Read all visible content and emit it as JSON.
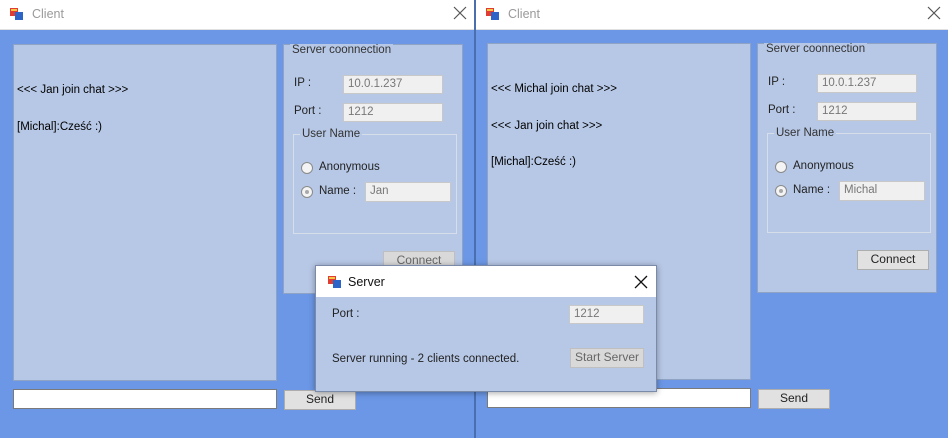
{
  "left_window": {
    "title": "Client",
    "chat_lines": [
      "<<< Jan join chat >>>",
      "[Michal]:Cześć :)"
    ],
    "connection": {
      "group_title": "Server coonnection",
      "ip_label": "IP :",
      "ip_value": "10.0.1.237",
      "port_label": "Port :",
      "port_value": "1212"
    },
    "user_name": {
      "group_title": "User Name",
      "anonymous_label": "Anonymous",
      "name_label": "Name :",
      "name_value": "Jan",
      "selected": "name"
    },
    "connect_label": "Connect",
    "message_value": "",
    "send_label": "Send"
  },
  "right_window": {
    "title": "Client",
    "chat_lines": [
      "<<< Michal join chat >>>",
      "<<< Jan join chat >>>",
      "[Michal]:Cześć :)"
    ],
    "connection": {
      "group_title": "Server coonnection",
      "ip_label": "IP :",
      "ip_value": "10.0.1.237",
      "port_label": "Port :",
      "port_value": "1212"
    },
    "user_name": {
      "group_title": "User Name",
      "anonymous_label": "Anonymous",
      "name_label": "Name :",
      "name_value": "Michal",
      "selected": "name"
    },
    "connect_label": "Connect",
    "message_value": "",
    "send_label": "Send"
  },
  "server_dialog": {
    "title": "Server",
    "port_label": "Port :",
    "port_value": "1212",
    "status": "Server running - 2 clients connected.",
    "start_label": "Start Server"
  },
  "icons": {
    "window_icon": "app-window-icon",
    "close": "close-icon"
  },
  "colors": {
    "form_background": "#6b97e6",
    "panel_background": "#b7c8e6",
    "titlebar": "#ffffff"
  }
}
